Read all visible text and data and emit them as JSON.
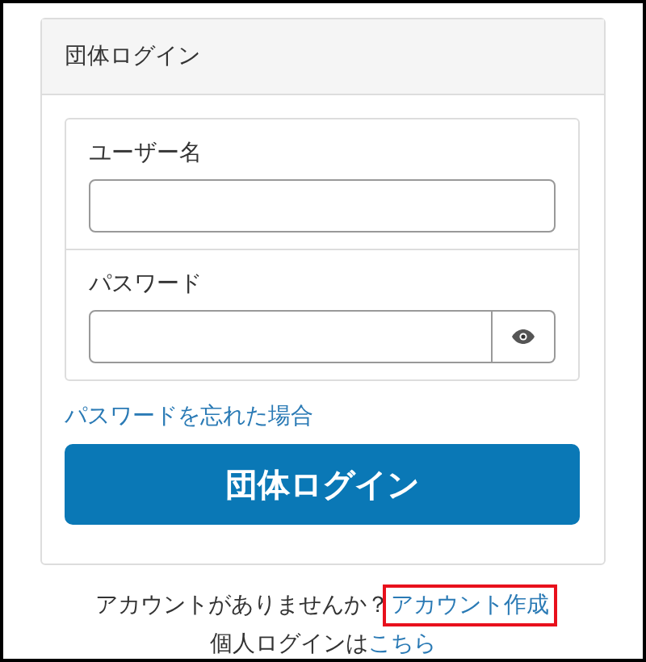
{
  "panel": {
    "title": "団体ログイン"
  },
  "fields": [
    {
      "label": "ユーザー名",
      "kind": "text"
    },
    {
      "label": "パスワード",
      "kind": "password"
    }
  ],
  "forgot_link": "パスワードを忘れた場合",
  "login_button": "団体ログイン",
  "footer": [
    {
      "text": "アカウントがありませんか？",
      "link": "アカウント作成",
      "highlighted": true
    },
    {
      "text": "個人ログインは",
      "link": "こちら",
      "highlighted": false
    }
  ]
}
